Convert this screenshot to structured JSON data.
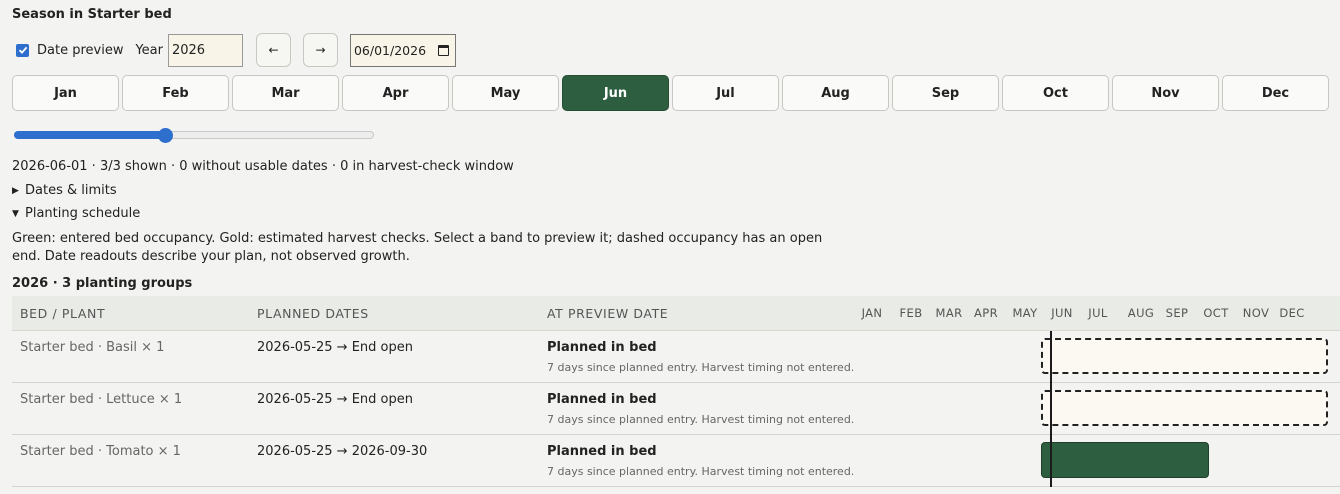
{
  "title": "Season in Starter bed",
  "controls": {
    "date_preview_checked": true,
    "date_preview_label": "Date preview",
    "year_label": "Year",
    "year_value": "2026",
    "prev_label": "←",
    "next_label": "→",
    "date_value": "06/01/2026"
  },
  "months": [
    "Jan",
    "Feb",
    "Mar",
    "Apr",
    "May",
    "Jun",
    "Jul",
    "Aug",
    "Sep",
    "Oct",
    "Nov",
    "Dec"
  ],
  "selected_month": "Jun",
  "slider": {
    "fraction": 0.42
  },
  "summary": "2026-06-01 · 3/3 shown · 0 without usable dates · 0 in harvest-check window",
  "dates_limits_label": "Dates & limits",
  "schedule_label": "Planting schedule",
  "description": "Green: entered bed occupancy. Gold: estimated harvest checks. Select a band to preview it; dashed occupancy has an open end. Date readouts describe your plan, not observed growth.",
  "groups_title": "2026 · 3 planting groups",
  "table": {
    "headers": {
      "bed_plant": "BED / PLANT",
      "planned_dates": "PLANNED DATES",
      "at_preview": "AT PREVIEW DATE"
    },
    "month_headers": [
      "JAN",
      "FEB",
      "MAR",
      "APR",
      "MAY",
      "JUN",
      "JUL",
      "AUG",
      "SEP",
      "OCT",
      "NOV",
      "DEC"
    ],
    "rows": [
      {
        "bed_plant": "Starter bed · Basil × 1",
        "dates": "2026-05-25 → End open",
        "status": "Planned in bed",
        "note": "7 days since planned entry. Harvest timing not entered.",
        "band_type": "open"
      },
      {
        "bed_plant": "Starter bed · Lettuce × 1",
        "dates": "2026-05-25 → End open",
        "status": "Planned in bed",
        "note": "7 days since planned entry. Harvest timing not entered.",
        "band_type": "open"
      },
      {
        "bed_plant": "Starter bed · Tomato × 1",
        "dates": "2026-05-25 → 2026-09-30",
        "status": "Planned in bed",
        "note": "7 days since planned entry. Harvest timing not entered.",
        "band_type": "solid"
      }
    ]
  },
  "colors": {
    "accent": "#2e6fce",
    "active_month": "#2d5e3f",
    "occupancy": "#2d5e3f",
    "background": "#f3f4f1"
  }
}
